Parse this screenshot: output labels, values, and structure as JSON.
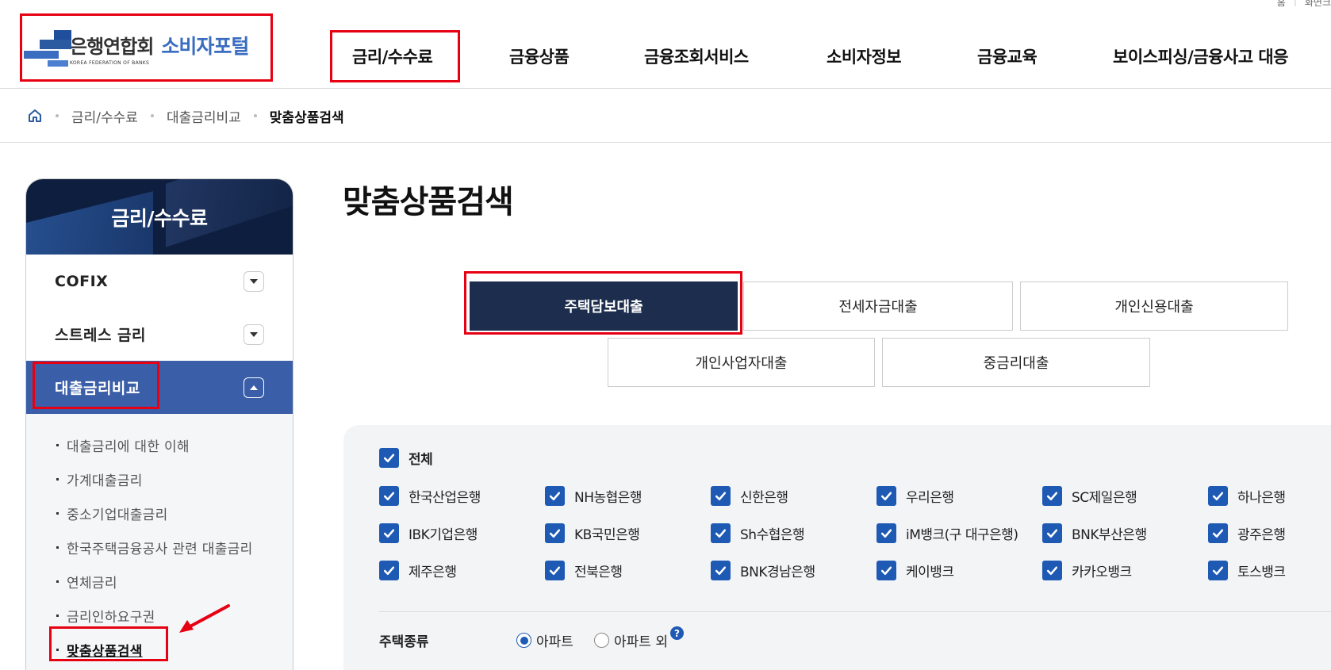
{
  "util": {
    "home": "홈",
    "zoom": "화면크"
  },
  "logo": {
    "kr": "은행연합회",
    "portal": "소비자포털",
    "en": "KOREA FEDERATION OF BANKS"
  },
  "gnb": [
    "금리/수수료",
    "금융상품",
    "금융조회서비스",
    "소비자정보",
    "금융교육",
    "보이스피싱/금융사고 대응"
  ],
  "breadcrumb": {
    "level1": "금리/수수료",
    "level2": "대출금리비교",
    "current": "맞춤상품검색"
  },
  "sidebar": {
    "title": "금리/수수료",
    "items": [
      {
        "label": "COFIX"
      },
      {
        "label": "스트레스 금리"
      },
      {
        "label": "대출금리비교"
      }
    ],
    "sub_items": [
      "대출금리에 대한 이해",
      "가계대출금리",
      "중소기업대출금리",
      "한국주택금융공사 관련 대출금리",
      "연체금리",
      "금리인하요구권",
      "맞춤상품검색"
    ]
  },
  "page_title": "맞춤상품검색",
  "tabs": [
    "주택담보대출",
    "전세자금대출",
    "개인신용대출",
    "개인사업자대출",
    "중금리대출"
  ],
  "filter": {
    "all_label": "전체",
    "banks": [
      [
        "한국산업은행",
        "NH농협은행",
        "신한은행",
        "우리은행",
        "SC제일은행",
        "하나은행"
      ],
      [
        "IBK기업은행",
        "KB국민은행",
        "Sh수협은행",
        "iM뱅크(구 대구은행)",
        "BNK부산은행",
        "광주은행"
      ],
      [
        "제주은행",
        "전북은행",
        "BNK경남은행",
        "케이뱅크",
        "카카오뱅크",
        "토스뱅크"
      ]
    ],
    "house_type_label": "주택종류",
    "house_type_options": [
      "아파트",
      "아파트 외"
    ],
    "help_mark": "?"
  },
  "colors": {
    "accent": "#1e5ab4",
    "nav_dark": "#1d2d4d",
    "active_blue": "#3a5ea8",
    "highlight": "#e60012"
  }
}
